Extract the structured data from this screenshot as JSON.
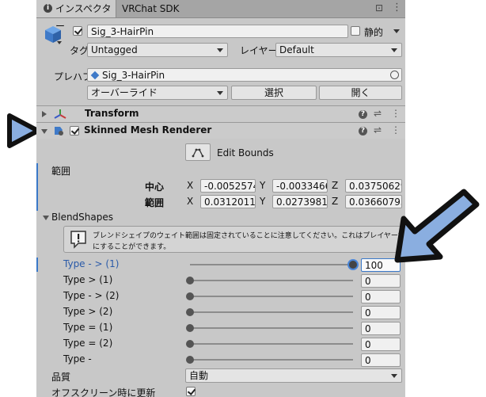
{
  "tabs": {
    "inspector": "インスペクター",
    "sdk": "VRChat SDK"
  },
  "object": {
    "name": "Sig_3-HairPin",
    "static_label": "静的",
    "tag_label": "タグ",
    "tag_value": "Untagged",
    "layer_label": "レイヤー",
    "layer_value": "Default",
    "prefab_label": "プレハブ",
    "prefab_value": "Sig_3-HairPin",
    "override_value": "オーバーライド",
    "select_button": "選択",
    "open_button": "開く"
  },
  "components": {
    "transform": "Transform",
    "renderer": "Skinned Mesh Renderer",
    "edit_bounds": "Edit Bounds"
  },
  "bounds": {
    "section_label": "範囲",
    "center_label": "中心",
    "extent_label": "範囲",
    "x": "X",
    "y": "Y",
    "z": "Z",
    "center": [
      "-0.00525749",
      "-0.0033466",
      "0.03750629"
    ],
    "extent": [
      "0.03120118",
      "0.02739815",
      "0.03660793"
    ]
  },
  "blendshapes": {
    "label": "BlendShapes",
    "help_line1": "ブレンドシェイプのウェイト範囲は固定されていることに注意してください。これはプレイヤー設定で無効",
    "help_line2": "にすることができます。",
    "items": [
      {
        "name": "Type - > (1)",
        "value": "100",
        "level": 1.0
      },
      {
        "name": "Type > (1)",
        "value": "0",
        "level": 0.0
      },
      {
        "name": "Type - > (2)",
        "value": "0",
        "level": 0.0
      },
      {
        "name": "Type > (2)",
        "value": "0",
        "level": 0.0
      },
      {
        "name": "Type = (1)",
        "value": "0",
        "level": 0.0
      },
      {
        "name": "Type = (2)",
        "value": "0",
        "level": 0.0
      },
      {
        "name": "Type -",
        "value": "0",
        "level": 0.0
      }
    ]
  },
  "quality": {
    "label": "品質",
    "value": "自動"
  },
  "offscreen": {
    "label": "オフスクリーン時に更新"
  },
  "colors": {
    "accent_arrow": "#8aaee0",
    "highlight_text": "#2a5aa8"
  }
}
